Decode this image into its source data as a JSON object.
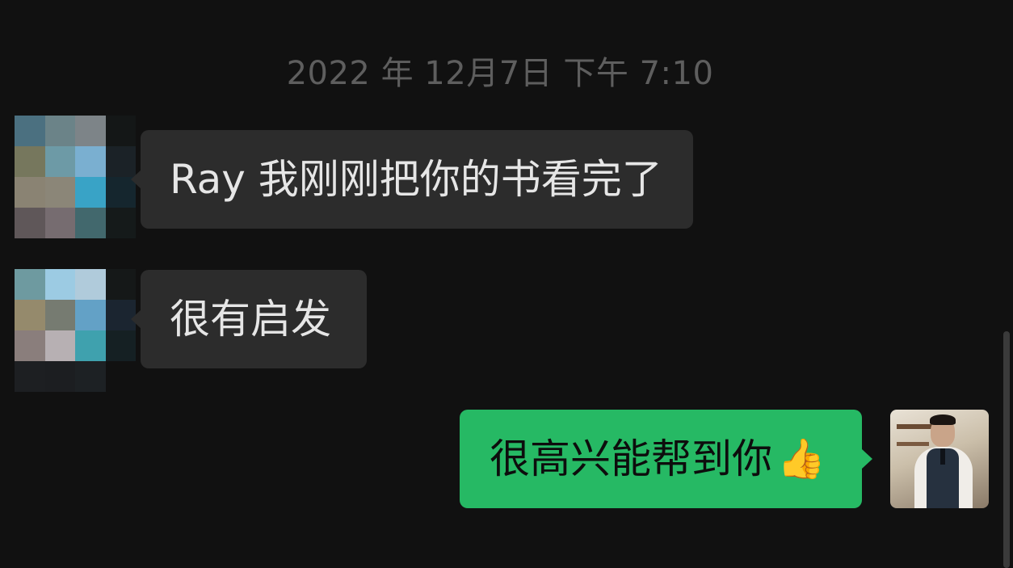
{
  "timestamp": "2022 年 12月7日 下午 7:10",
  "messages": [
    {
      "sender": "other",
      "text": "Ray 我刚刚把你的书看完了"
    },
    {
      "sender": "other",
      "text": "很有启发"
    },
    {
      "sender": "self",
      "text": "很高兴能帮到你",
      "emoji": "👍"
    }
  ],
  "colors": {
    "background": "#111111",
    "incoming_bubble": "#2c2c2c",
    "outgoing_bubble": "#26b964",
    "timestamp": "#5e5e5e"
  },
  "avatars": {
    "other": "pixelated-avatar",
    "self": "photo-avatar"
  }
}
